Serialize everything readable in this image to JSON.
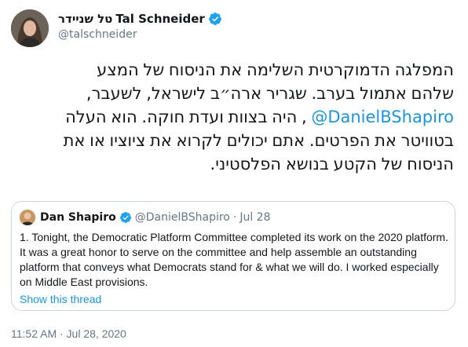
{
  "author": {
    "hebrew_name": "טל שניידר",
    "name": "Tal Schneider",
    "handle": "@talschneider",
    "verified": true
  },
  "tweet": {
    "lines": [
      {
        "text": "המפלגה הדמוקרטית השלימה את הניסוח של המצע"
      },
      {
        "text": "שלהם אתמול בערב. שגריר ארה״ב לישראל, לשעבר,"
      },
      {
        "before": "",
        "mention": "@DanielBShapiro",
        "after": " , היה בצוות ועדת חוקה. הוא העלה"
      },
      {
        "text": "בטוויטר את הפרטים. אתם יכולים לקרוא את ציוציו או את"
      },
      {
        "text": "הניסוח של הקטע בנושא הפלסטיני."
      }
    ]
  },
  "quoted_tweet": {
    "name": "Dan Shapiro",
    "verified": true,
    "handle": "@DanielBShapiro",
    "separator": "·",
    "date": "Jul 28",
    "text": "1. Tonight, the Democratic Platform Committee completed its work on the 2020 platform. It was a great honor to serve on the committee and help assemble an outstanding platform that conveys what Democrats stand for & what we will do. I worked especially on Middle East provisions.",
    "show_thread": "Show this thread"
  },
  "timestamp": "11:52 AM · Jul 28, 2020",
  "colors": {
    "link": "#1b95e0",
    "verified": "#1da1f2",
    "secondary_text": "#657786",
    "border": "#ccd6dd"
  },
  "icons": {
    "verified": "verified-badge-icon"
  }
}
